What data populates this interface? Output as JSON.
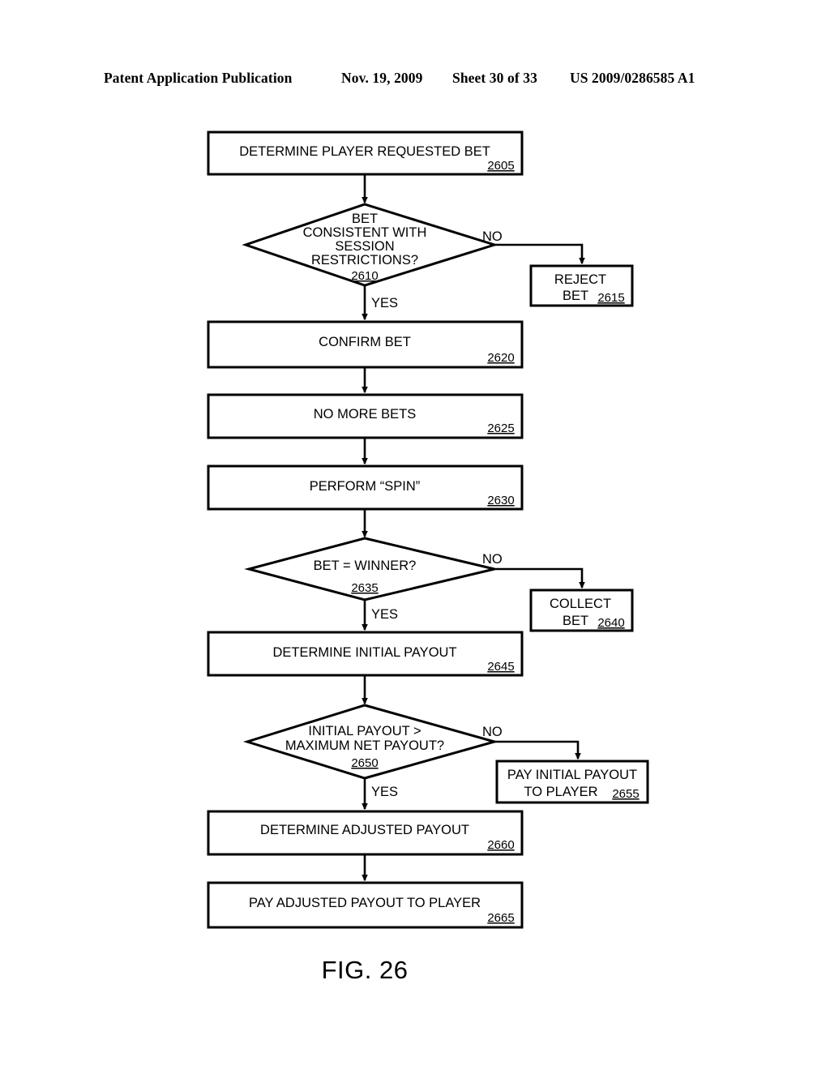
{
  "header": {
    "publication": "Patent Application Publication",
    "date": "Nov. 19, 2009",
    "sheet": "Sheet 30 of 33",
    "patent_number": "US 2009/0286585 A1"
  },
  "figure": {
    "caption": "FIG. 26",
    "type": "flowchart"
  },
  "chart_data": {
    "type": "flowchart",
    "title": "FIG. 26",
    "nodes": [
      {
        "id": "2605",
        "shape": "process",
        "label": "DETERMINE PLAYER REQUESTED BET",
        "ref": "2605"
      },
      {
        "id": "2610",
        "shape": "decision",
        "label": "BET CONSISTENT WITH SESSION RESTRICTIONS?",
        "ref": "2610"
      },
      {
        "id": "2615",
        "shape": "process",
        "label": "REJECT BET",
        "ref": "2615"
      },
      {
        "id": "2620",
        "shape": "process",
        "label": "CONFIRM BET",
        "ref": "2620"
      },
      {
        "id": "2625",
        "shape": "process",
        "label": "NO MORE BETS",
        "ref": "2625"
      },
      {
        "id": "2630",
        "shape": "process",
        "label": "PERFORM “SPIN”",
        "ref": "2630"
      },
      {
        "id": "2635",
        "shape": "decision",
        "label": "BET = WINNER?",
        "ref": "2635"
      },
      {
        "id": "2640",
        "shape": "process",
        "label": "COLLECT BET",
        "ref": "2640"
      },
      {
        "id": "2645",
        "shape": "process",
        "label": "DETERMINE INITIAL PAYOUT",
        "ref": "2645"
      },
      {
        "id": "2650",
        "shape": "decision",
        "label": "INITIAL PAYOUT > MAXIMUM NET PAYOUT?",
        "ref": "2650"
      },
      {
        "id": "2655",
        "shape": "process",
        "label": "PAY INITIAL PAYOUT TO PLAYER",
        "ref": "2655"
      },
      {
        "id": "2660",
        "shape": "process",
        "label": "DETERMINE ADJUSTED PAYOUT",
        "ref": "2660"
      },
      {
        "id": "2665",
        "shape": "process",
        "label": "PAY ADJUSTED PAYOUT TO PLAYER",
        "ref": "2665"
      }
    ],
    "edges": [
      {
        "from": "2605",
        "to": "2610",
        "label": ""
      },
      {
        "from": "2610",
        "to": "2615",
        "label": "NO"
      },
      {
        "from": "2610",
        "to": "2620",
        "label": "YES"
      },
      {
        "from": "2620",
        "to": "2625",
        "label": ""
      },
      {
        "from": "2625",
        "to": "2630",
        "label": ""
      },
      {
        "from": "2630",
        "to": "2635",
        "label": ""
      },
      {
        "from": "2635",
        "to": "2640",
        "label": "NO"
      },
      {
        "from": "2635",
        "to": "2645",
        "label": "YES"
      },
      {
        "from": "2645",
        "to": "2650",
        "label": ""
      },
      {
        "from": "2650",
        "to": "2655",
        "label": "NO"
      },
      {
        "from": "2650",
        "to": "2660",
        "label": "YES"
      },
      {
        "from": "2660",
        "to": "2665",
        "label": ""
      }
    ]
  },
  "nodes": {
    "n2605": {
      "line1": "DETERMINE PLAYER REQUESTED BET",
      "ref": "2605"
    },
    "n2610": {
      "line1": "BET",
      "line2": "CONSISTENT WITH",
      "line3": "SESSION",
      "line4": "RESTRICTIONS?",
      "ref": "2610"
    },
    "n2615": {
      "line1": "REJECT",
      "line2": "BET",
      "ref": "2615"
    },
    "n2620": {
      "line1": "CONFIRM BET",
      "ref": "2620"
    },
    "n2625": {
      "line1": "NO MORE BETS",
      "ref": "2625"
    },
    "n2630": {
      "line1": "PERFORM “SPIN”",
      "ref": "2630"
    },
    "n2635": {
      "line1": "BET = WINNER?",
      "ref": "2635"
    },
    "n2640": {
      "line1": "COLLECT",
      "line2": "BET",
      "ref": "2640"
    },
    "n2645": {
      "line1": "DETERMINE INITIAL PAYOUT",
      "ref": "2645"
    },
    "n2650": {
      "line1": "INITIAL PAYOUT >",
      "line2": "MAXIMUM NET PAYOUT?",
      "ref": "2650"
    },
    "n2655": {
      "line1": "PAY INITIAL PAYOUT",
      "line2": "TO PLAYER",
      "ref": "2655"
    },
    "n2660": {
      "line1": "DETERMINE ADJUSTED PAYOUT",
      "ref": "2660"
    },
    "n2665": {
      "line1": "PAY ADJUSTED PAYOUT TO PLAYER",
      "ref": "2665"
    }
  },
  "branches": {
    "no_2610": "NO",
    "yes_2610": "YES",
    "no_2635": "NO",
    "yes_2635": "YES",
    "no_2650": "NO",
    "yes_2650": "YES"
  },
  "colors": {
    "ink": "#000000",
    "paper": "#ffffff"
  }
}
